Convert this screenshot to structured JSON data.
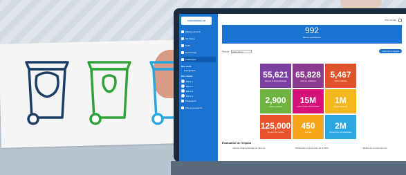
{
  "sidebar": {
    "logo": "CONTAINERCLUB",
    "items": [
      {
        "label": "Tableau de bord"
      },
      {
        "label": "Ma classe"
      },
      {
        "label": "Défis"
      },
      {
        "label": "Ressources"
      },
      {
        "label": "Statistiques",
        "active": true
      }
    ],
    "section_title": "Mon école",
    "section_sub": "Enseignants",
    "team_title": "Mon équipe",
    "team": [
      {
        "name": "Élève 1"
      },
      {
        "name": "Élève 2"
      },
      {
        "name": "Élève 3"
      },
      {
        "name": "Élève 4"
      }
    ],
    "footer_items": [
      {
        "label": "Paramètres"
      },
      {
        "label": "Aide et assistance"
      }
    ]
  },
  "topbar": {
    "user": "Mon compte"
  },
  "hero": {
    "value": "992",
    "label": "Élèves participants"
  },
  "filter": {
    "label": "Période",
    "selected": "Cette année",
    "report_button": "Générer le rapport"
  },
  "tiles": [
    {
      "value": "55,621",
      "desc": "Heures d'apprentissage",
      "color": "#7b3fa0"
    },
    {
      "value": "65,828",
      "desc": "Actions réalisées",
      "color": "#8a3b8f"
    },
    {
      "value": "5,467",
      "desc": "Défis réalisés",
      "color": "#e0532a"
    },
    {
      "value": "2,900",
      "desc": "Arbres plantés",
      "color": "#6eb33f"
    },
    {
      "value": "15M",
      "desc": "Litres d'eau économisés",
      "color": "#d6127a"
    },
    {
      "value": "1M",
      "desc": "Kg de déchets",
      "color": "#f5b81c"
    },
    {
      "value": "125,000",
      "desc": "Kg de CO2 évités",
      "color": "#e9532b"
    },
    {
      "value": "450",
      "desc": "Écoles",
      "color": "#f6a51a"
    },
    {
      "value": "2M",
      "desc": "Personnes sensibilisées",
      "color": "#2aa6e0"
    }
  ],
  "impact": {
    "title": "Évaluation de l'impact",
    "cols": [
      "Heures d'apprentissage en plein air",
      "Participation à la journée de la Terre",
      "Jardins de l'environnement"
    ]
  }
}
